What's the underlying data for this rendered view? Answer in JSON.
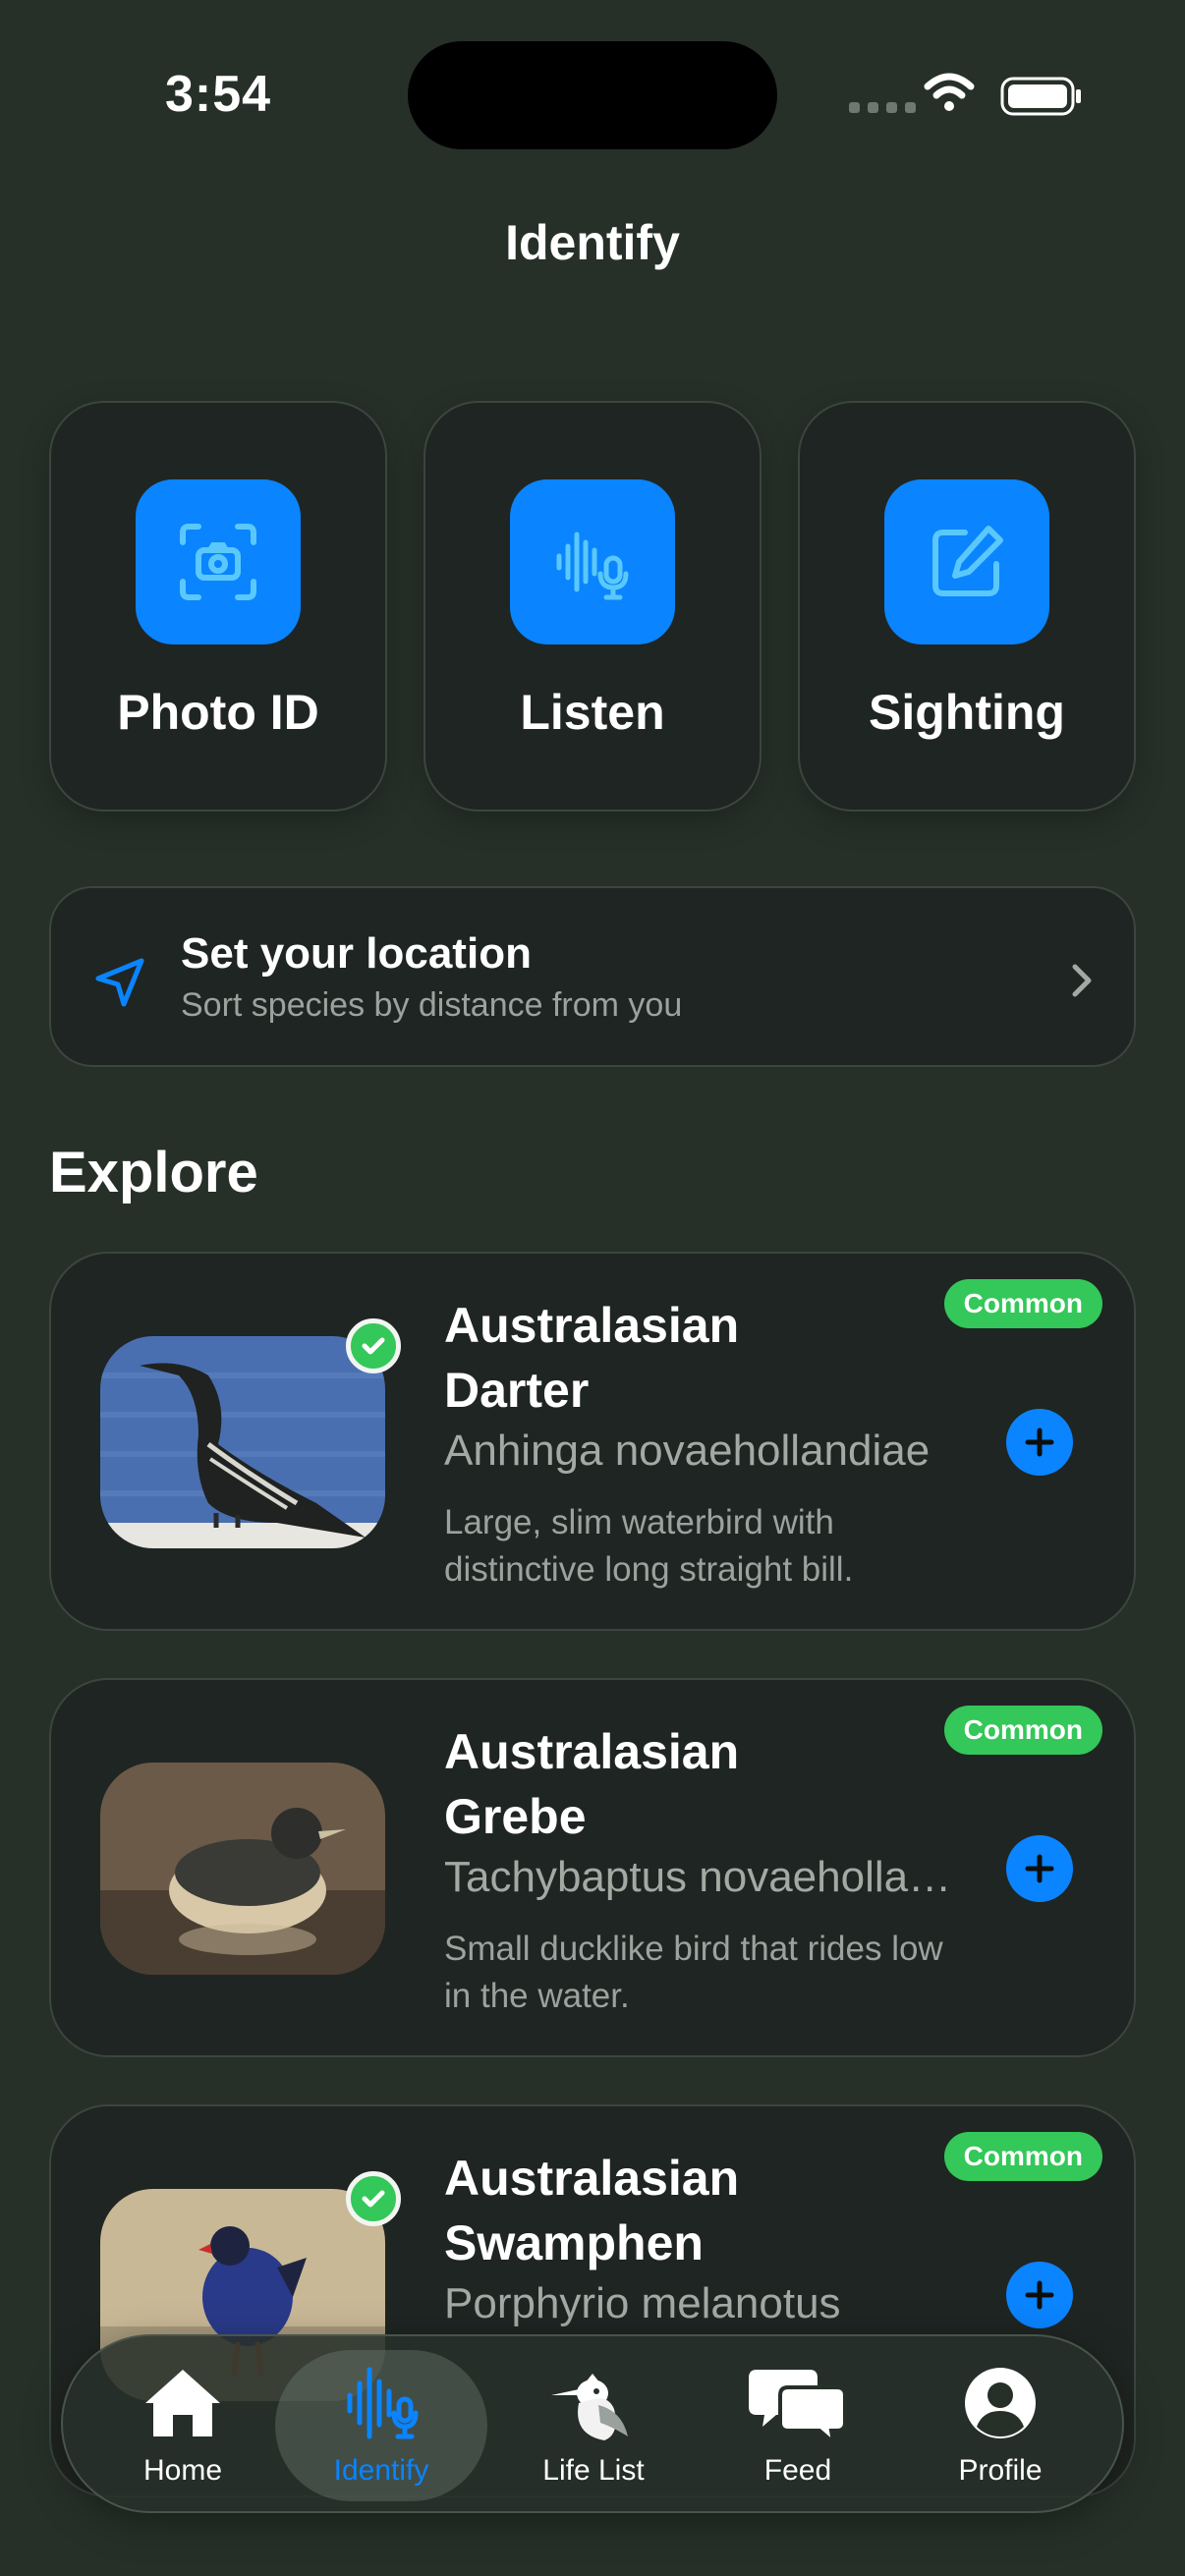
{
  "status_bar": {
    "time": "3:54"
  },
  "header": {
    "title": "Identify"
  },
  "actions": [
    {
      "label": "Photo ID",
      "icon": "camera-viewfinder-icon"
    },
    {
      "label": "Listen",
      "icon": "waveform-mic-icon"
    },
    {
      "label": "Sighting",
      "icon": "square-pencil-icon"
    }
  ],
  "location": {
    "title": "Set your location",
    "subtitle": "Sort species by distance from you",
    "icon": "location-arrow-icon"
  },
  "explore": {
    "title": "Explore",
    "cards": [
      {
        "name": "Australasian Darter",
        "scientific": "Anhinga novaehollandiae",
        "description": "Large, slim waterbird with distinctive long straight bill.",
        "badge": "Common",
        "seen": true
      },
      {
        "name": "Australasian Grebe",
        "scientific": "Tachybaptus novaehollandiae",
        "description": "Small ducklike bird that rides low in the water.",
        "badge": "Common",
        "seen": false
      },
      {
        "name": "Australasian Swamphen",
        "scientific": "Porphyrio melanotus",
        "description": "",
        "badge": "Common",
        "seen": true
      }
    ]
  },
  "tabs": [
    {
      "label": "Home",
      "icon": "house-icon",
      "active": false
    },
    {
      "label": "Identify",
      "icon": "waveform-mic-icon",
      "active": true
    },
    {
      "label": "Life List",
      "icon": "kookaburra-icon",
      "active": false
    },
    {
      "label": "Feed",
      "icon": "chat-bubbles-icon",
      "active": false
    },
    {
      "label": "Profile",
      "icon": "person-circle-icon",
      "active": false
    }
  ],
  "colors": {
    "accent": "#0a84ff",
    "common_badge": "#34c759",
    "background": "#263029",
    "card": "#1f2522"
  }
}
